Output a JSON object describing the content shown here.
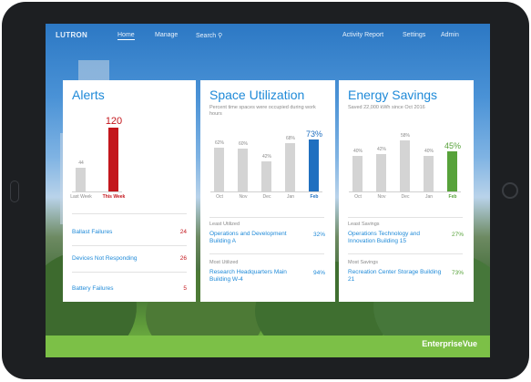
{
  "nav": {
    "logo": "LUTRON",
    "items": [
      "Home",
      "Manage",
      "Search ⚲"
    ],
    "right_items": [
      "Activity Report",
      "Settings",
      "Admin"
    ]
  },
  "alerts": {
    "title": "Alerts",
    "chart_data": {
      "type": "bar",
      "categories": [
        "Last Week",
        "This Week"
      ],
      "values": [
        44,
        120
      ],
      "value_labels": [
        "44",
        "120"
      ],
      "highlight_color": "#c3161c"
    },
    "rows": [
      {
        "label": "Ballast Failures",
        "value": "24"
      },
      {
        "label": "Devices Not Responding",
        "value": "26"
      },
      {
        "label": "Battery Failures",
        "value": "5"
      }
    ]
  },
  "space": {
    "title": "Space Utilization",
    "subtitle": "Percent time spaces were occupied during work hours",
    "chart_data": {
      "type": "bar",
      "categories": [
        "Oct",
        "Nov",
        "Dec",
        "Jan",
        "Feb"
      ],
      "values": [
        62,
        60,
        42,
        68,
        73
      ],
      "value_labels": [
        "62%",
        "60%",
        "42%",
        "68%",
        "73%"
      ],
      "highlight_color": "#1f6fc0"
    },
    "least_label": "Least Utilized",
    "least_name": "Operations and Development Building A",
    "least_value": "32%",
    "most_label": "Most Utilized",
    "most_name": "Research Headquarters Main Building W-4",
    "most_value": "94%"
  },
  "energy": {
    "title": "Energy Savings",
    "subtitle": "Saved 22,000 kWh since Oct 2016",
    "chart_data": {
      "type": "bar",
      "categories": [
        "Oct",
        "Nov",
        "Dec",
        "Jan",
        "Feb"
      ],
      "values": [
        40,
        42,
        58,
        40,
        45
      ],
      "value_labels": [
        "40%",
        "42%",
        "58%",
        "40%",
        "45%"
      ],
      "highlight_color": "#57a23a"
    },
    "least_label": "Least Savings",
    "least_name": "Operations Technology and Innovation Building 15",
    "least_value": "27%",
    "most_label": "Most Savings",
    "most_name": "Recreation Center Storage Building 21",
    "most_value": "73%"
  },
  "brand": "EnterpriseVue"
}
